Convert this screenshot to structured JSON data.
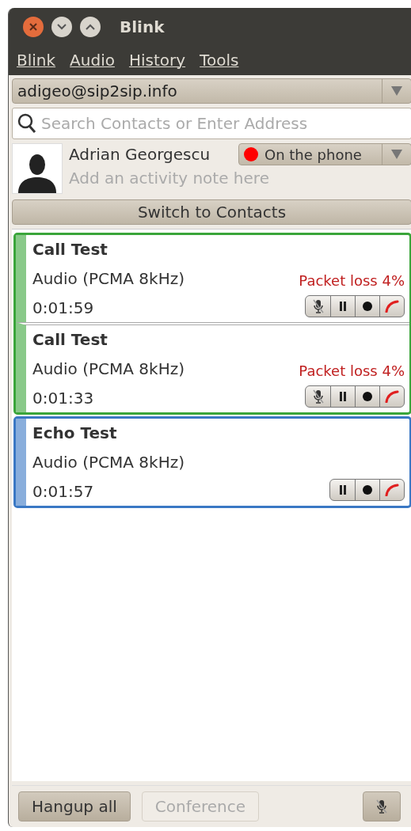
{
  "window": {
    "title": "Blink"
  },
  "menu": [
    {
      "label": "Blink"
    },
    {
      "label": "Audio"
    },
    {
      "label": "History"
    },
    {
      "label": "Tools"
    }
  ],
  "account": {
    "value": "adigeo@sip2sip.info"
  },
  "search": {
    "placeholder": "Search Contacts or Enter Address"
  },
  "profile": {
    "name": "Adrian Georgescu",
    "note_placeholder": "Add an activity note here",
    "status": {
      "label": "On the phone",
      "color": "#ff0000"
    }
  },
  "switch_button": {
    "label": "Switch to Contacts"
  },
  "session_groups": [
    {
      "color": "#3aa53a",
      "sessions": [
        {
          "name": "Call Test",
          "codec": "Audio (PCMA 8kHz)",
          "duration": "0:01:59",
          "warning": "Packet loss 4%",
          "controls": [
            {
              "kind": "mute"
            },
            {
              "kind": "hold"
            },
            {
              "kind": "record"
            },
            {
              "kind": "hangup"
            }
          ]
        },
        {
          "name": "Call Test",
          "codec": "Audio (PCMA 8kHz)",
          "duration": "0:01:33",
          "warning": "Packet loss 4%",
          "controls": [
            {
              "kind": "mute"
            },
            {
              "kind": "hold"
            },
            {
              "kind": "record"
            },
            {
              "kind": "hangup"
            }
          ]
        }
      ]
    },
    {
      "color": "#3a78c4",
      "sessions": [
        {
          "name": "Echo Test",
          "codec": "Audio (PCMA 8kHz)",
          "duration": "0:01:57",
          "controls": [
            {
              "kind": "hold"
            },
            {
              "kind": "record"
            },
            {
              "kind": "hangup"
            }
          ]
        }
      ]
    }
  ],
  "footer": {
    "buttons": [
      {
        "label": "Hangup all",
        "disabled": false
      },
      {
        "label": "Conference",
        "disabled": true
      }
    ]
  }
}
